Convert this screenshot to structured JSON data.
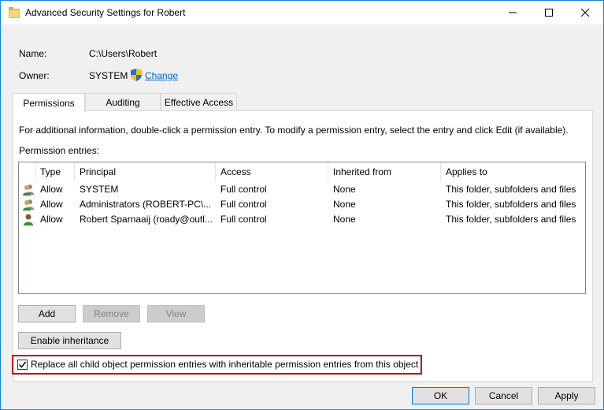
{
  "window": {
    "title": "Advanced Security Settings for Robert",
    "icon": "folder-icon",
    "controls": [
      "minimize-icon",
      "maximize-icon",
      "close-icon"
    ]
  },
  "header": {
    "name_label": "Name:",
    "name_value": "C:\\Users\\Robert",
    "owner_label": "Owner:",
    "owner_value": "SYSTEM",
    "change_link": "Change"
  },
  "tabs": [
    {
      "label": "Permissions",
      "active": true
    },
    {
      "label": "Auditing",
      "active": false
    },
    {
      "label": "Effective Access",
      "active": false
    }
  ],
  "permissions": {
    "info_text": "For additional information, double-click a permission entry. To modify a permission entry, select the entry and click Edit (if available).",
    "entries_label": "Permission entries:",
    "columns": [
      "Type",
      "Principal",
      "Access",
      "Inherited from",
      "Applies to"
    ],
    "rows": [
      {
        "type": "Allow",
        "principal": "SYSTEM",
        "access": "Full control",
        "inherited": "None",
        "applies": "This folder, subfolders and files",
        "icon": "group-user-icon"
      },
      {
        "type": "Allow",
        "principal": "Administrators (ROBERT-PC\\...",
        "access": "Full control",
        "inherited": "None",
        "applies": "This folder, subfolders and files",
        "icon": "group-user-icon"
      },
      {
        "type": "Allow",
        "principal": "Robert Sparnaaij (roady@outl...",
        "access": "Full control",
        "inherited": "None",
        "applies": "This folder, subfolders and files",
        "icon": "single-user-icon"
      }
    ]
  },
  "buttons": {
    "add": "Add",
    "remove": "Remove",
    "view": "View",
    "enable_inheritance": "Enable inheritance",
    "ok": "OK",
    "cancel": "Cancel",
    "apply": "Apply"
  },
  "replace_checkbox": {
    "label": "Replace all child object permission entries with inheritable permission entries from this object",
    "checked": true
  },
  "colors": {
    "highlight": "#c00000",
    "link": "#0066cc",
    "window_border": "#1883d7"
  }
}
